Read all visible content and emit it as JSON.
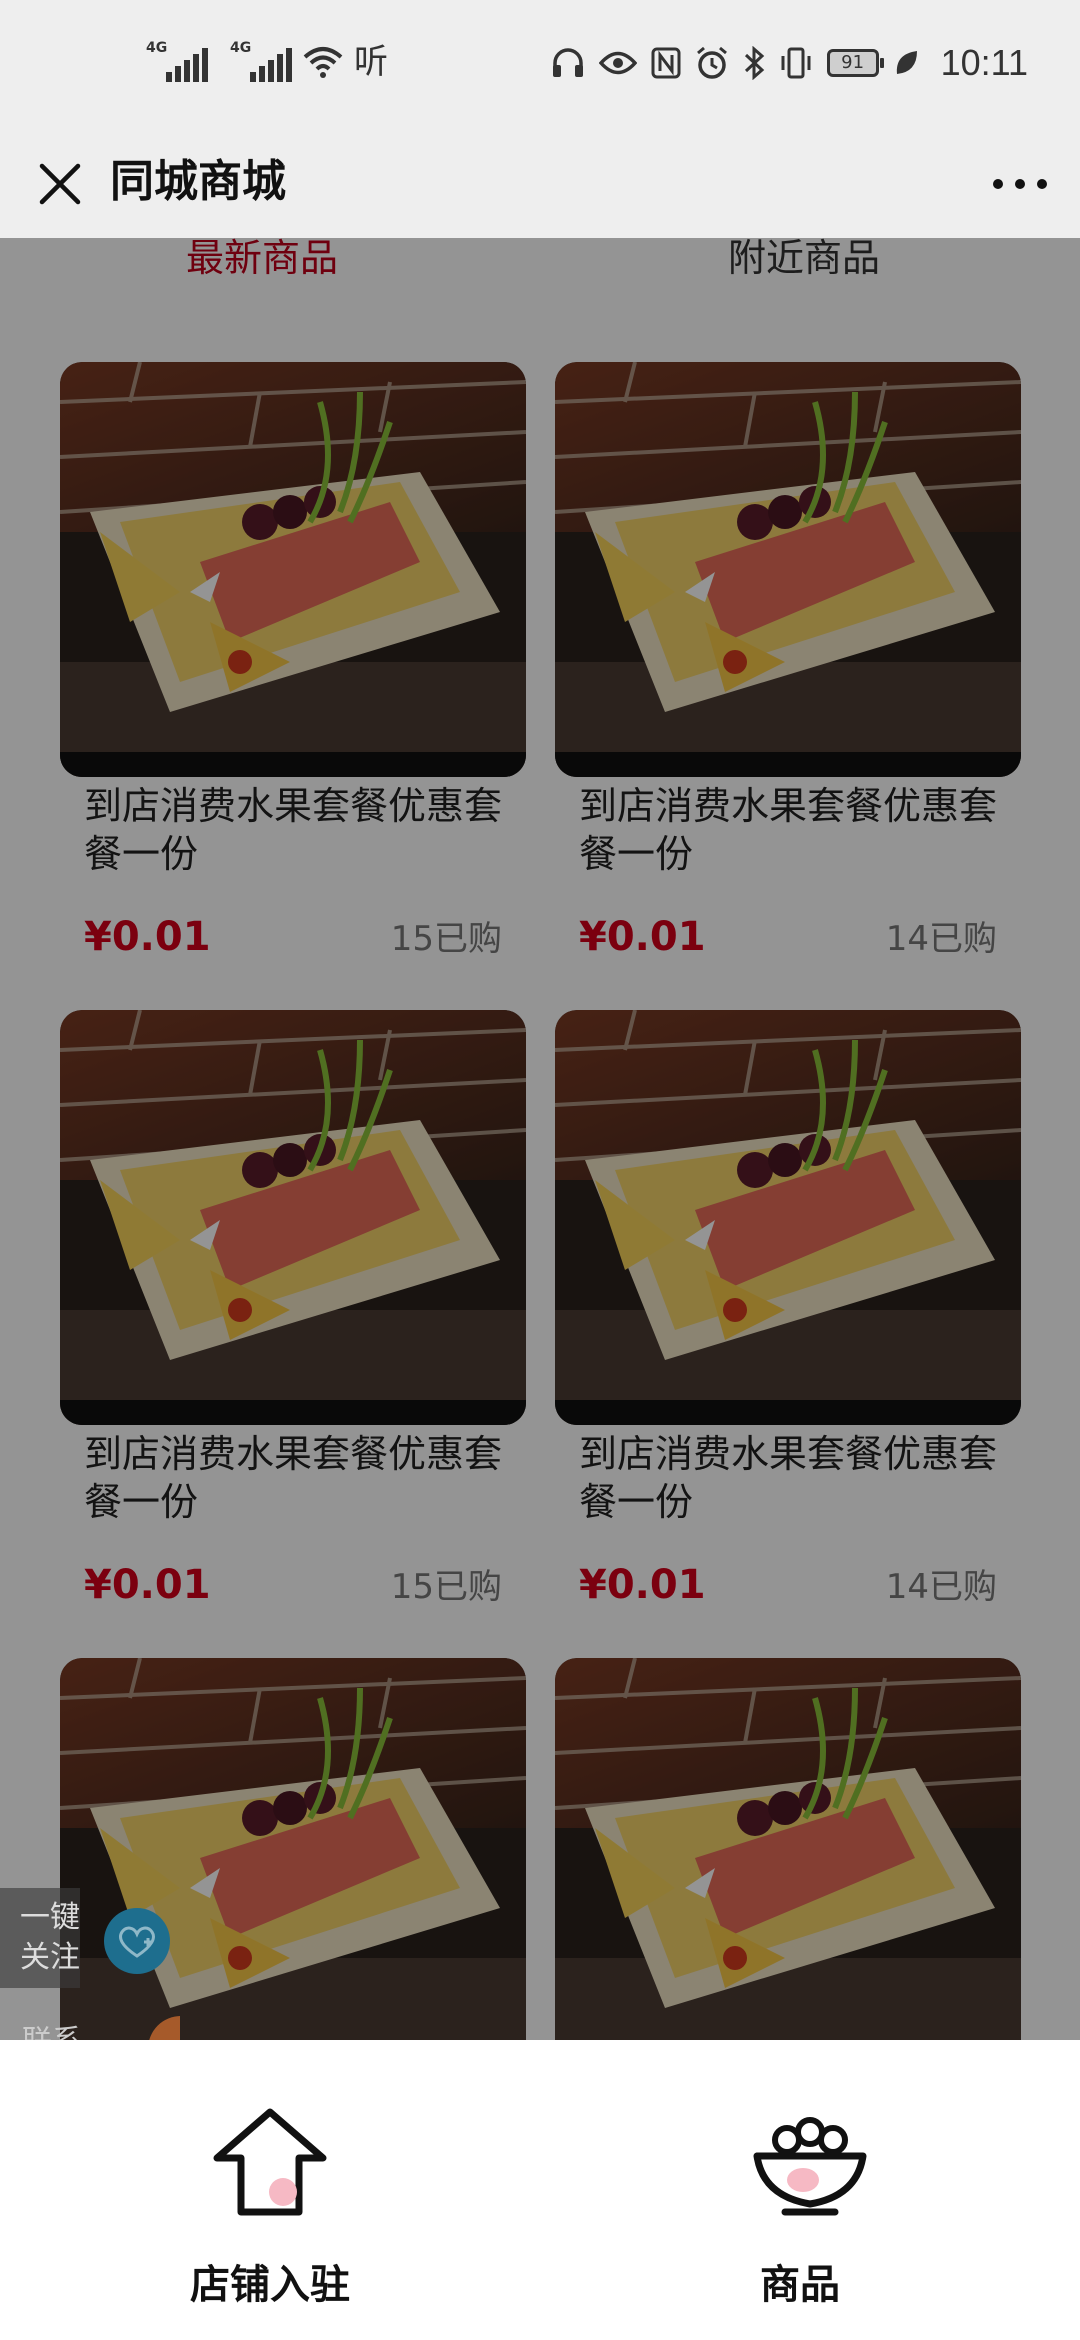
{
  "status_bar": {
    "net1": "4G",
    "net2": "4G",
    "hd": "听",
    "battery": "91",
    "time": "10:11"
  },
  "header": {
    "title": "同城商城"
  },
  "tabs": [
    {
      "label": "最新商品"
    },
    {
      "label": "附近商品"
    }
  ],
  "products": [
    {
      "name": "到店消费水果套餐优惠套餐一份",
      "price": "¥0.01",
      "sold": "15已购"
    },
    {
      "name": "到店消费水果套餐优惠套餐一份",
      "price": "¥0.01",
      "sold": "14已购"
    },
    {
      "name": "到店消费水果套餐优惠套餐一份",
      "price": "¥0.01",
      "sold": "15已购"
    },
    {
      "name": "到店消费水果套餐优惠套餐一份",
      "price": "¥0.01",
      "sold": "14已购"
    },
    {
      "name": "",
      "price": "",
      "sold": ""
    },
    {
      "name": "",
      "price": "",
      "sold": ""
    }
  ],
  "floating": {
    "follow_label": "一键关注",
    "contact_label": "联系"
  },
  "bottom_nav": [
    {
      "label": "店铺入驻",
      "icon": "house-upload-icon"
    },
    {
      "label": "商品",
      "icon": "fruit-bowl-icon"
    }
  ],
  "colors": {
    "accent": "#c0001a",
    "price": "#d4001a",
    "header_bg": "#eeeeee"
  }
}
